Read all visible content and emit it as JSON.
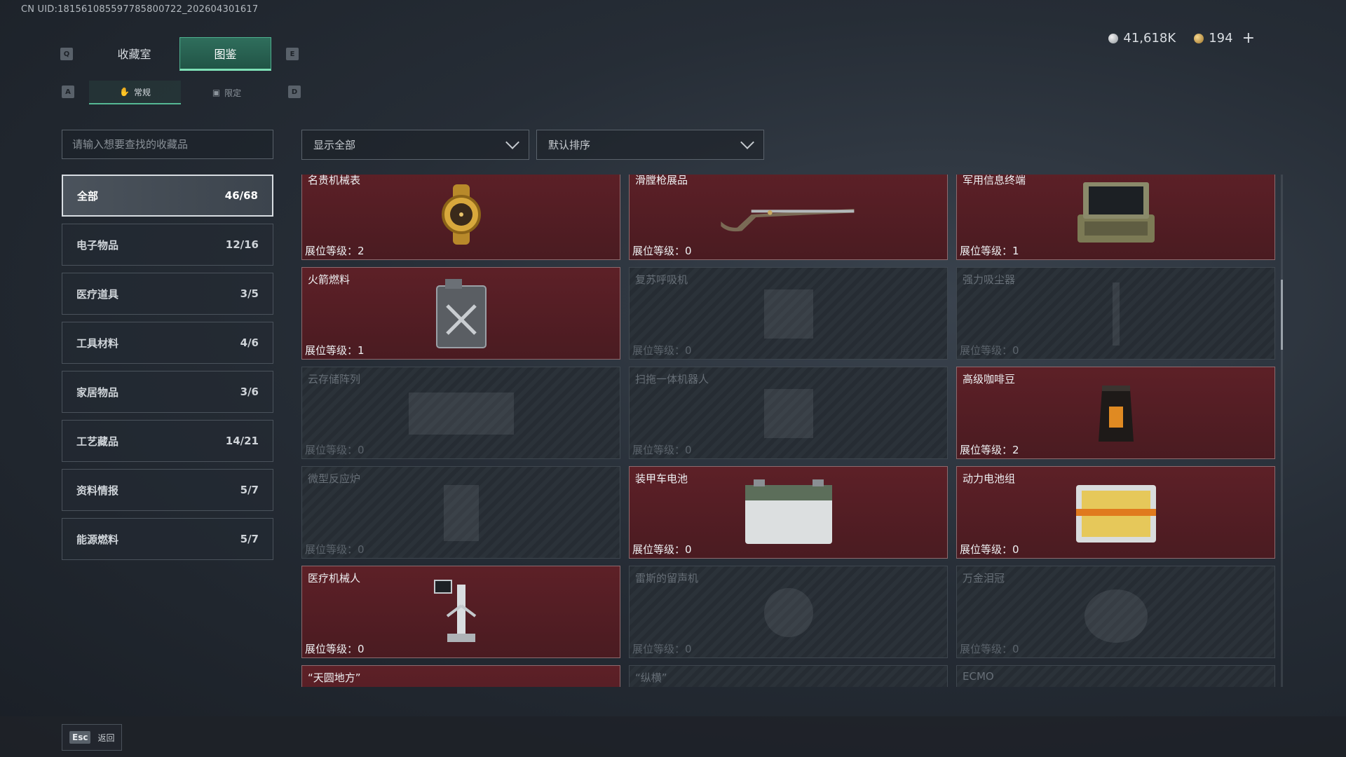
{
  "uid": "CN UID:18156108559778580072​2_202604301617",
  "currency": {
    "silver_value": "41,618K",
    "gold_value": "194",
    "plus_label": "+"
  },
  "keys": {
    "prev_tab": "Q",
    "next_tab": "E",
    "prev_subtab": "A",
    "next_subtab": "D"
  },
  "main_tabs": [
    {
      "label": "收藏室"
    },
    {
      "label": "图鉴"
    }
  ],
  "sub_tabs": [
    {
      "label": "常规"
    },
    {
      "label": "限定"
    }
  ],
  "search": {
    "placeholder": "请输入想要查找的收藏品"
  },
  "filters": {
    "show": "显示全部",
    "sort": "默认排序"
  },
  "categories": [
    {
      "label": "全部",
      "count": "46/68"
    },
    {
      "label": "电子物品",
      "count": "12/16"
    },
    {
      "label": "医疗道具",
      "count": "3/5"
    },
    {
      "label": "工具材料",
      "count": "4/6"
    },
    {
      "label": "家居物品",
      "count": "3/6"
    },
    {
      "label": "工艺藏品",
      "count": "14/21"
    },
    {
      "label": "资料情报",
      "count": "5/7"
    },
    {
      "label": "能源燃料",
      "count": "5/7"
    }
  ],
  "cards": [
    {
      "name": "名贵机械表",
      "level": "展位等级：2",
      "icon": "gold-watch-icon",
      "locked": false
    },
    {
      "name": "滑膛枪展品",
      "level": "展位等级：0",
      "icon": "musket-icon",
      "locked": false
    },
    {
      "name": "军用信息终端",
      "level": "展位等级：1",
      "icon": "military-terminal-icon",
      "locked": false
    },
    {
      "name": "火箭燃料",
      "level": "展位等级：1",
      "icon": "fuel-canister-icon",
      "locked": false
    },
    {
      "name": "复苏呼吸机",
      "level": "展位等级：0",
      "icon": "ventilator-icon",
      "locked": true
    },
    {
      "name": "强力吸尘器",
      "level": "展位等级：0",
      "icon": "vacuum-icon",
      "locked": true
    },
    {
      "name": "云存储阵列",
      "level": "展位等级：0",
      "icon": "storage-array-icon",
      "locked": true
    },
    {
      "name": "扫拖一体机器人",
      "level": "展位等级：0",
      "icon": "robot-vacuum-icon",
      "locked": true
    },
    {
      "name": "高级咖啡豆",
      "level": "展位等级：2",
      "icon": "coffee-bag-icon",
      "locked": false
    },
    {
      "name": "微型反应炉",
      "level": "展位等级：0",
      "icon": "reactor-icon",
      "locked": true
    },
    {
      "name": "装甲车电池",
      "level": "展位等级：0",
      "icon": "car-battery-icon",
      "locked": false
    },
    {
      "name": "动力电池组",
      "level": "展位等级：0",
      "icon": "battery-pack-icon",
      "locked": false
    },
    {
      "name": "医疗机械人",
      "level": "展位等级：0",
      "icon": "medical-robot-icon",
      "locked": false
    },
    {
      "name": "雷斯的留声机",
      "level": "展位等级：0",
      "icon": "gramophone-icon",
      "locked": true
    },
    {
      "name": "万金泪冠",
      "level": "展位等级：0",
      "icon": "crown-icon",
      "locked": true
    },
    {
      "name": "“天圆地方”",
      "level": "",
      "icon": "gold-compass-icon",
      "locked": false
    },
    {
      "name": "“纵横”",
      "level": "",
      "icon": "item-icon",
      "locked": true
    },
    {
      "name": "ECMO",
      "level": "",
      "icon": "ecmo-icon",
      "locked": true
    }
  ],
  "footer": {
    "esc_key": "Esc",
    "back_label": "返回"
  },
  "colors": {
    "accent": "#4fb08f",
    "card_unlocked": "#5d2027",
    "card_locked": "#2b3239"
  }
}
